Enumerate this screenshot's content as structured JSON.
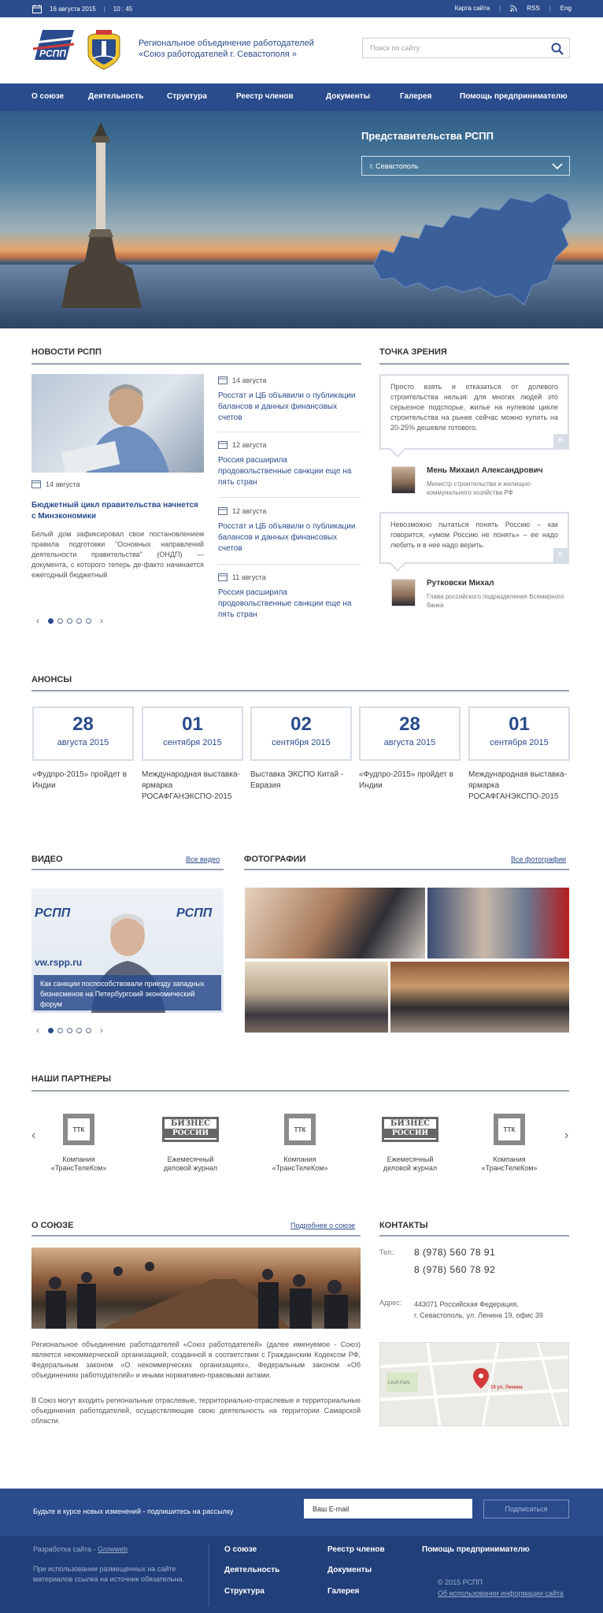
{
  "topbar": {
    "date": "16 августа 2015",
    "time": "10 : 45",
    "sitemap": "Карта сайта",
    "rss": "RSS",
    "lang": "Eng"
  },
  "header": {
    "org_line1": "Региональное объединение работодателей",
    "org_line2": "«Союз работодателей  г. Севастополя »",
    "search_placeholder": "Поиск по сайту",
    "logo_text": "РСПП"
  },
  "nav": [
    "О союзе",
    "Деятельность",
    "Структура",
    "Реестр членов",
    "Документы",
    "Галерея",
    "Помощь предпринимателю"
  ],
  "hero": {
    "title": "Представительства РСПП",
    "city": "г. Севастополь"
  },
  "news": {
    "title": "НОВОСТИ РСПП",
    "main": {
      "date": "14 августа",
      "headline": "Бюджетный цикл правительства начнется с Минэкономики",
      "body": "Белый дом зафиксировал свои постановлением правила подготовки \"Основных направлений деятельности правительства\" (ОНДП) — документа, с которого теперь де-факто начинается ежегодный бюджетный"
    },
    "items": [
      {
        "date": "14 августа",
        "text": "Росстат и ЦБ объявили о публикации балансов и данных финансовых счетов"
      },
      {
        "date": "12 августа",
        "text": "Россия расширила продовольственные санкции еще на пять стран"
      },
      {
        "date": "12 августа",
        "text": "Росстат и ЦБ объявили о публикации балансов и данных финансовых счетов"
      },
      {
        "date": "11 августа",
        "text": "Россия расширила продовольственные санкции еще на пять стран"
      }
    ]
  },
  "viewpoint": {
    "title": "ТОЧКА ЗРЕНИЯ",
    "quotes": [
      {
        "text": "Просто взять и отказаться от долевого строительства нельзя: для многих людей это серьезное подспорье, жилье на нулевом цикле строительства на рынке сейчас можно купить на 20-25% дешевле готового.",
        "name": "Мень Михаил Александрович",
        "position": "Министр строительства и жилищно-коммунального хозяйства РФ"
      },
      {
        "text": "Невозможно пытаться понять Россию – как говорится, «умом Россию не понять» – ее надо любить и в нее надо верить.",
        "name": "Рутковски Михал",
        "position": "Глава российского подразделения Всемирного банка"
      }
    ]
  },
  "announcements": {
    "title": "АНОНСЫ",
    "items": [
      {
        "day": "28",
        "month": "августа 2015",
        "text": "«Фудпро-2015» пройдет в Индии"
      },
      {
        "day": "01",
        "month": "сентября 2015",
        "text": "Международная выставка-ярмарка РОСАФГАНЭКСПО-2015"
      },
      {
        "day": "02",
        "month": "сентября 2015",
        "text": "Выставка ЭКСПО Китай - Евразия"
      },
      {
        "day": "28",
        "month": "августа 2015",
        "text": "«Фудпро-2015» пройдет в Индии"
      },
      {
        "day": "01",
        "month": "сентября 2015",
        "text": "Международная выставка-ярмарка РОСАФГАНЭКСПО-2015"
      }
    ]
  },
  "video": {
    "title": "ВИДЕО",
    "all_link": "Все видео",
    "caption": "Как санкции поспособствовали приезду западных бизнесменов на Петербургский экономический форум",
    "watermark": "vw.rspp.ru"
  },
  "photos": {
    "title": "ФОТОГРАФИИ",
    "all_link": "Все фотографии"
  },
  "partners": {
    "title": "НАШИ ПАРТНЕРЫ",
    "items": [
      {
        "logo": "ТТК",
        "caption1": "Компания",
        "caption2": "«ТрансТелеКом»"
      },
      {
        "logo1": "БИЗНЕС",
        "logo2": "РОССИИ",
        "caption1": "Ежемесячный",
        "caption2": "деловой журнал"
      },
      {
        "logo": "ТТК",
        "caption1": "Компания",
        "caption2": "«ТрансТелеКом»"
      },
      {
        "logo1": "БИЗНЕС",
        "logo2": "РОССИИ",
        "caption1": "Ежемесячный",
        "caption2": "деловой журнал"
      },
      {
        "logo": "ТТК",
        "caption1": "Компания",
        "caption2": "«ТрансТелеКом»"
      }
    ]
  },
  "about": {
    "title": "О СОЮЗЕ",
    "more_link": "Подробнее о союзе",
    "p1": "Региональное объединение работодателей «Союз работодателей» (далее именуемое - Союз) является некоммерческой организацией, созданной в соответствии с Гражданским Кодексом РФ, Федеральным законом «О некоммерческих организациях», Федеральным законом «Об объединениях работодателей» и иными нормативно-правовыми актами.",
    "p2": "В Союз могут входить региональные отраслевые, территориально-отраслевые и территориальные объединения работодателей, осуществляющие свою деятельность на территории Самарской области."
  },
  "contacts": {
    "title": "КОНТАКТЫ",
    "tel_label": "Тел.:",
    "phone1": "8 (978) 560 78 91",
    "phone2": "8 (978) 560 78 92",
    "addr_label": "Адрес:",
    "addr1": "443071 Российская Федерация,",
    "addr2": "г. Севастополь, ул. Ленина 19, офис 39",
    "map_pin": "19 ул. Ленина",
    "map_park": "Leuft Park"
  },
  "subscribe": {
    "text": "Будьте в курсе новых изменений - подпишитесь на рассылку",
    "placeholder": "Ваш E-mail",
    "button": "Подписаться"
  },
  "footer": {
    "dev_prefix": "Разработка сайта - ",
    "dev_link": "Growweb",
    "note": "При использовании размещенных на сайте материалов ссылка на источник обязательна.",
    "links": [
      "О союзе",
      "Реестр членов",
      "Помощь предпринимателю",
      "Деятельность",
      "Документы",
      "Структура",
      "Галерея"
    ],
    "copyright": "© 2015 РСПП",
    "terms": "Об использовании информации сайта"
  },
  "colors": {
    "brand": "#2a4b8c",
    "footer": "#213f78"
  }
}
